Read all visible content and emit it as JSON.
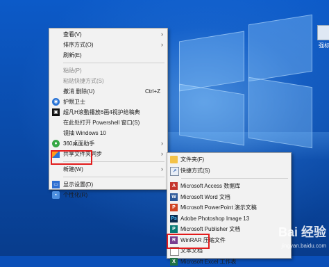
{
  "desktop": {
    "icon_label": "强标"
  },
  "context_menu": {
    "items": [
      {
        "label": "查看(V)",
        "arrow": "›",
        "icon": "none"
      },
      {
        "label": "排序方式(O)",
        "arrow": "›",
        "icon": "none"
      },
      {
        "label": "刷新(E)",
        "icon": "none"
      },
      {
        "label": "粘贴(P)",
        "disabled": true,
        "icon": "none"
      },
      {
        "label": "粘贴快捷方式(S)",
        "disabled": true,
        "icon": "none"
      },
      {
        "label": "撤消 删除(U)",
        "shortcut": "Ctrl+Z",
        "icon": "none"
      },
      {
        "label": "护眼卫士",
        "icon": "shield-icon"
      },
      {
        "label": "超凡H滚動播放6画4视护给稿典",
        "icon": "app-icon"
      },
      {
        "label": "在此处打开 Powershell 窗口(S)",
        "icon": "none"
      },
      {
        "label": "镜抽 Windows 10",
        "icon": "none"
      },
      {
        "label": "360桌面助手",
        "arrow": "›",
        "icon": "360-icon"
      },
      {
        "label": "共享文件夹同步",
        "arrow": "›",
        "icon": "sync-icon"
      },
      {
        "label": "新建(W)",
        "arrow": "›",
        "icon": "none"
      },
      {
        "label": "显示设置(D)",
        "icon": "display-icon"
      },
      {
        "label": "个性化(R)",
        "icon": "personalize-icon"
      }
    ]
  },
  "new_submenu": {
    "items": [
      {
        "label": "文件夹(F)",
        "icon": "folder-icon"
      },
      {
        "label": "快捷方式(S)",
        "icon": "shortcut-icon"
      },
      {
        "label": "Microsoft Access 数据库",
        "icon": "access-icon"
      },
      {
        "label": "Microsoft Word 文档",
        "icon": "word-icon"
      },
      {
        "label": "Microsoft PowerPoint 演示文稿",
        "icon": "powerpoint-icon"
      },
      {
        "label": "Adobe Photoshop Image 13",
        "icon": "photoshop-icon"
      },
      {
        "label": "Microsoft Publisher 文档",
        "icon": "publisher-icon"
      },
      {
        "label": "WinRAR 压缩文件",
        "icon": "winrar-icon"
      },
      {
        "label": "文本文档",
        "icon": "text-document-icon"
      },
      {
        "label": "Microsoft Excel 工作表",
        "icon": "excel-icon"
      }
    ]
  },
  "watermark": {
    "text": "Bai 经验",
    "sub": "jingyan.baidu.com"
  },
  "colors": {
    "highlight_box": "#e21b1b",
    "menu_bg": "#f2f2f2"
  }
}
